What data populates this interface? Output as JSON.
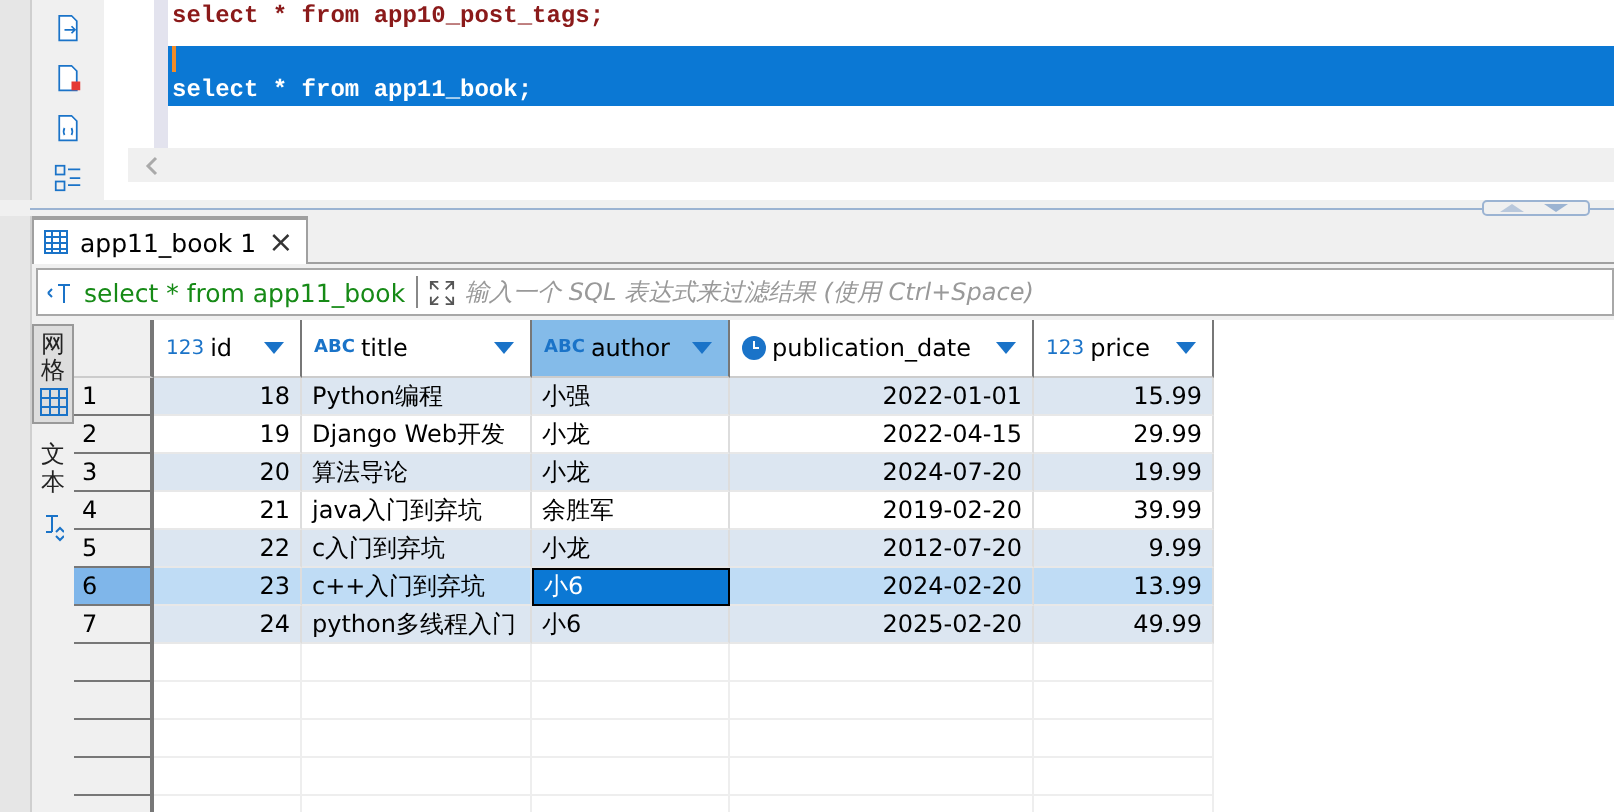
{
  "editor": {
    "lines": [
      {
        "text": "select * from app10_post_tags;",
        "selected": false
      },
      {
        "selected": true
      },
      {
        "text": "select * from app11_book;",
        "selected": true
      }
    ]
  },
  "result_tab": {
    "label": "app11_book 1",
    "close": "×"
  },
  "filter": {
    "query": "select * from app11_book",
    "placeholder": "输入一个 SQL 表达式来过滤结果 (使用 Ctrl+Space)"
  },
  "side_tabs": [
    {
      "label": "网格",
      "selected": true
    },
    {
      "label": "文本",
      "selected": false
    }
  ],
  "table": {
    "columns": [
      {
        "name": "id",
        "kind": "number",
        "type_label": "123",
        "selected": false
      },
      {
        "name": "title",
        "kind": "string",
        "type_label": "ABC",
        "selected": false
      },
      {
        "name": "author",
        "kind": "string",
        "type_label": "ABC",
        "selected": true
      },
      {
        "name": "publication_date",
        "kind": "date",
        "selected": false
      },
      {
        "name": "price",
        "kind": "number",
        "type_label": "123",
        "selected": false
      }
    ],
    "rows": [
      {
        "num": "1",
        "selected": false,
        "cells": [
          "18",
          "Python编程",
          "小强",
          "2022-01-01",
          "15.99"
        ]
      },
      {
        "num": "2",
        "selected": false,
        "cells": [
          "19",
          "Django Web开发",
          "小龙",
          "2022-04-15",
          "29.99"
        ]
      },
      {
        "num": "3",
        "selected": false,
        "cells": [
          "20",
          "算法导论",
          "小龙",
          "2024-07-20",
          "19.99"
        ]
      },
      {
        "num": "4",
        "selected": false,
        "cells": [
          "21",
          "java入门到弃坑",
          "余胜军",
          "2019-02-20",
          "39.99"
        ]
      },
      {
        "num": "5",
        "selected": false,
        "cells": [
          "22",
          "c入门到弃坑",
          "小龙",
          "2012-07-20",
          "9.99"
        ]
      },
      {
        "num": "6",
        "selected": true,
        "cells": [
          "23",
          "c++入门到弃坑",
          "小6",
          "2024-02-20",
          "13.99"
        ]
      },
      {
        "num": "7",
        "selected": false,
        "cells": [
          "24",
          "python多线程入门",
          "小6",
          "2025-02-20",
          "49.99"
        ]
      }
    ]
  }
}
